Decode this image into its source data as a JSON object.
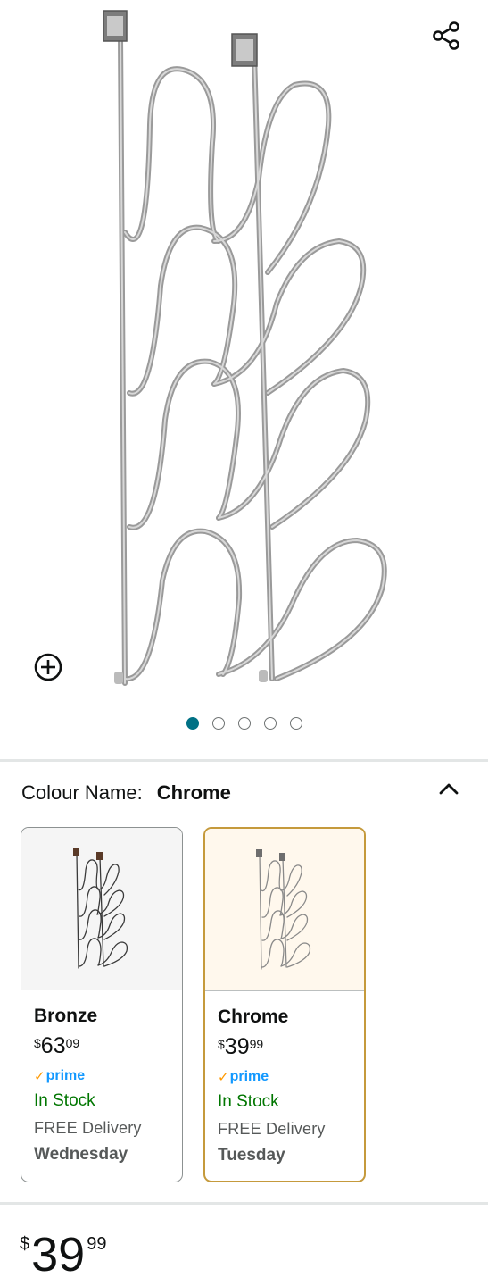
{
  "product": {
    "image_alt": "Over-the-door hat rack, chrome",
    "gallery": {
      "image_count": 5,
      "active_index": 0,
      "accent_color": "#007185"
    },
    "share_icon": "share-icon",
    "zoom_icon": "zoom-in-icon"
  },
  "variation": {
    "label": "Colour Name:",
    "selected": "Chrome",
    "collapse_icon": "chevron-up-icon",
    "options": [
      {
        "name": "Bronze",
        "price": {
          "symbol": "$",
          "whole": "63",
          "fraction": "09"
        },
        "prime": "prime",
        "stock": "In Stock",
        "delivery": "FREE Delivery",
        "delivery_day": "Wednesday",
        "selected": false
      },
      {
        "name": "Chrome",
        "price": {
          "symbol": "$",
          "whole": "39",
          "fraction": "99"
        },
        "prime": "prime",
        "stock": "In Stock",
        "delivery": "FREE Delivery",
        "delivery_day": "Tuesday",
        "selected": true
      }
    ]
  },
  "buy_box": {
    "price": {
      "symbol": "$",
      "whole": "39",
      "fraction": "99"
    }
  },
  "colors": {
    "stock_green": "#007600",
    "prime_blue": "#1399ff",
    "prime_check": "#ff9900",
    "selected_border": "#c59a3c",
    "selected_bg": "#fff8ed"
  }
}
